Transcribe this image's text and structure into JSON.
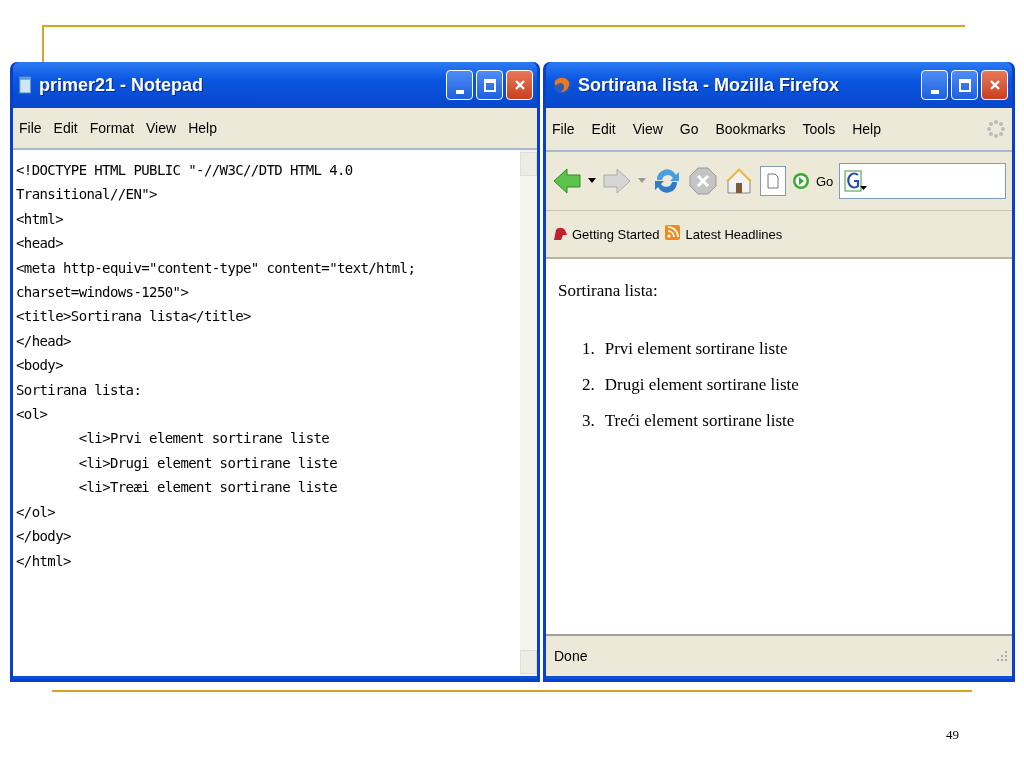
{
  "slide": {
    "page_number": "49"
  },
  "notepad": {
    "title": "primer21 - Notepad",
    "menu": [
      "File",
      "Edit",
      "Format",
      "View",
      "Help"
    ],
    "lines": [
      "<!DOCTYPE HTML PUBLIC \"-//W3C//DTD HTML 4.0",
      "Transitional//EN\">",
      "<html>",
      "<head>",
      "<meta http-equiv=\"content-type\" content=\"text/html;",
      "charset=windows-1250\">",
      "<title>Sortirana lista</title>",
      "</head>",
      "<body>",
      "Sortirana lista:",
      "<ol>",
      "\t<li>Prvi element sortirane liste",
      "\t<li>Drugi element sortirane liste",
      "\t<li>Treæi element sortirane liste",
      "</ol>",
      "</body>",
      "</html>"
    ]
  },
  "firefox": {
    "title": "Sortirana lista - Mozilla Firefox",
    "menu": [
      "File",
      "Edit",
      "View",
      "Go",
      "Bookmarks",
      "Tools",
      "Help"
    ],
    "go_label": "Go",
    "bookmarks": [
      {
        "kind": "page",
        "label": "Getting Started"
      },
      {
        "kind": "feed",
        "label": "Latest Headlines"
      }
    ],
    "page": {
      "heading": "Sortirana lista:",
      "items": [
        {
          "number": "1.",
          "text": "Prvi element sortirane liste"
        },
        {
          "number": "2.",
          "text": "Drugi element sortirane liste"
        },
        {
          "number": "3.",
          "text": "Treći element sortirane liste"
        }
      ]
    },
    "status": "Done"
  }
}
